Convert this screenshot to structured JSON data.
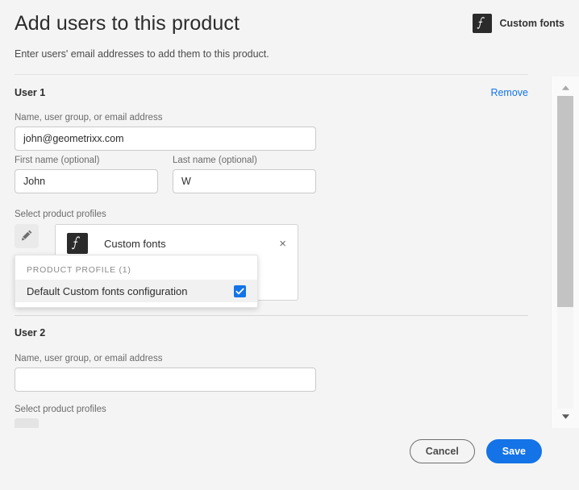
{
  "header": {
    "title": "Add users to this product",
    "subtitle": "Enter users' email addresses to add them to this product.",
    "product_badge": {
      "label": "Custom fonts",
      "icon": "custom-fonts-logo-icon",
      "glyph": "ƒ",
      "bg_color": "#2b2b2b"
    }
  },
  "users": [
    {
      "heading": "User 1",
      "remove_label": "Remove",
      "email_label": "Name, user group, or email address",
      "email_value": "john@geometrixx.com",
      "email_placeholder": "",
      "first_name_label": "First name (optional)",
      "first_name_value": "John",
      "last_name_label": "Last name (optional)",
      "last_name_value": "W",
      "profiles_label": "Select product profiles",
      "edit_icon": "pencil-icon",
      "chip": {
        "label": "Custom fonts",
        "glyph": "ƒ",
        "close_icon": "close-icon",
        "close_glyph": "×"
      }
    },
    {
      "heading": "User 2",
      "email_label": "Name, user group, or email address",
      "email_value": "",
      "email_placeholder": "",
      "profiles_label": "Select product profiles"
    }
  ],
  "profile_popup": {
    "section_title": "PRODUCT PROFILE (1)",
    "options": [
      {
        "label": "Default Custom fonts configuration",
        "checked": true,
        "checkbox_icon": "checkbox-checked-icon"
      }
    ]
  },
  "scrollbar": {
    "up_icon": "scroll-up-arrow-icon",
    "down_icon": "scroll-down-arrow-icon"
  },
  "footer": {
    "cancel_label": "Cancel",
    "save_label": "Save"
  },
  "colors": {
    "accent": "#1473e6",
    "link": "#1473e6",
    "page_bg": "#f4f4f4",
    "logo_bg": "#2b2b2b",
    "text": "#2c2c2c",
    "muted_text": "#6b6b6b"
  }
}
